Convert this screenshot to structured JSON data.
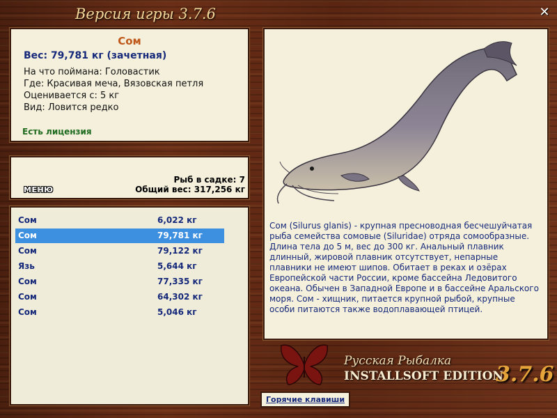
{
  "window": {
    "title": "Версия игры 3.7.6",
    "close_label": "✕"
  },
  "info": {
    "name": "Сом",
    "weight": "Вес: 79,781 кг (зачетная)",
    "bait": "На что поймана: Головастик",
    "location": "Где: Красивая меча, Вязовская петля",
    "rated": "Оценивается с: 5 кг",
    "rarity": "Вид: Ловится редко",
    "license": "Есть лицензия"
  },
  "cage": {
    "menu_label": "МЕНЮ",
    "count": "Рыб в садке: 7",
    "total": "Общий вес: 317,256 кг"
  },
  "fish_list": [
    {
      "name": "Сом",
      "weight": "6,022 кг"
    },
    {
      "name": "Сом",
      "weight": "79,781 кг"
    },
    {
      "name": "Сом",
      "weight": "79,122 кг"
    },
    {
      "name": "Язь",
      "weight": "5,644 кг"
    },
    {
      "name": "Сом",
      "weight": "77,335 кг"
    },
    {
      "name": "Сом",
      "weight": "64,302 кг"
    },
    {
      "name": "Сом",
      "weight": "5,046 кг"
    }
  ],
  "selected_index": 1,
  "description": "Сом (Silurus glanis) - крупная пресноводная бесчешуйчатая рыба семейства сомовые (Siluridae) отряда сомообразные. Длина тела до 5 м, вес до 300 кг. Анальный плавник длинный, жировой плавник отсутствует, непарные плавники не имеют шипов. Обитает в реках и озёрах Европейской части России, кроме бассейна Ледовитого океана. Обычен в Западной Европе и в бассейне Аральского моря. Сом - хищник, питается крупной рыбой, крупные особи питаются также водоплавающей птицей.",
  "logo": {
    "line1": "Русская Рыбалка",
    "line2": "INSTALLSOFT EDITION",
    "version": "3.7.6",
    "icon": "butterfly-icon"
  },
  "hotkeys_label": "Горячие клавиши",
  "colors": {
    "accent_name": "#c0581a",
    "text_blue": "#15287a",
    "license_green": "#1f6b1f",
    "selected_row": "#3d8fe0"
  }
}
